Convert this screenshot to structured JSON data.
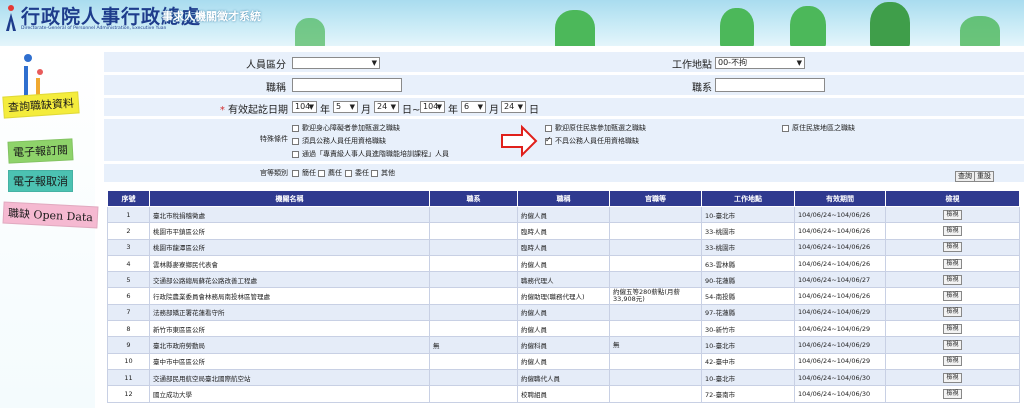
{
  "header": {
    "org_name": "行政院人事行政總處",
    "org_english": "Directorate-General of Personnel Administration, Executive Yuan",
    "system_title": "事求人機關徵才系統"
  },
  "sidebar": {
    "items": [
      {
        "label": "查詢職缺資料",
        "color": "#f4ec3c",
        "text_color": "#1a1a1a"
      },
      {
        "label": "電子報訂閱",
        "color": "#8ed36a",
        "text_color": "#1a1a1a"
      },
      {
        "label": "電子報取消",
        "color": "#4cc2b2",
        "text_color": "#1a1a1a"
      },
      {
        "label": "職缺 Open Data",
        "color": "#f5b9d1",
        "text_color": "#1a1a1a"
      }
    ]
  },
  "form": {
    "personnel_type_label": "人員區分",
    "personnel_type_value": "",
    "work_location_label": "工作地點",
    "work_location_value": "00-不拘",
    "title_label": "職稱",
    "title_value": "",
    "dept_label": "職系",
    "dept_value": "",
    "valid_date_label": "有效起訖日期",
    "required_mark": "*",
    "date_from": {
      "year": "104",
      "month": "5",
      "day": "24"
    },
    "date_to": {
      "year": "104",
      "month": "6",
      "day": "24"
    },
    "unit_year": "年",
    "unit_month": "月",
    "unit_day_range": "日~",
    "unit_day": "日",
    "special_label": "特殊條件",
    "special_options": [
      {
        "label": "歡迎身心障礙者參加甄選之職缺",
        "checked": false
      },
      {
        "label": "歡迎原住民族參加甄選之職缺",
        "checked": false
      },
      {
        "label": "原住民族地區之職缺",
        "checked": false
      },
      {
        "label": "須具公務人員任用資格職缺",
        "checked": false
      },
      {
        "label": "不具公務人員任用資格職缺",
        "checked": true
      },
      {
        "label": "通過「專責級人事人員進階職能培訓課程」人員",
        "checked": false
      }
    ],
    "rank_label": "官等類別",
    "rank_options": [
      {
        "label": "簡任",
        "checked": false
      },
      {
        "label": "薦任",
        "checked": false
      },
      {
        "label": "委任",
        "checked": false
      },
      {
        "label": "其他",
        "checked": false
      }
    ],
    "search_button": "查詢",
    "reset_button": "重設"
  },
  "table": {
    "headers": [
      "序號",
      "機關名稱",
      "職系",
      "職稱",
      "官職等",
      "工作地點",
      "有效期間",
      "檢視"
    ],
    "view_label": "檢視",
    "rows": [
      {
        "no": "1",
        "org": "臺北市稅捐稽徵處",
        "series": "",
        "title": "約僱人員",
        "rank": "",
        "location": "10-臺北市",
        "period": "104/06/24~104/06/26"
      },
      {
        "no": "2",
        "org": "桃園市平鎮區公所",
        "series": "",
        "title": "臨時人員",
        "rank": "",
        "location": "33-桃園市",
        "period": "104/06/24~104/06/26"
      },
      {
        "no": "3",
        "org": "桃園市龍潭區公所",
        "series": "",
        "title": "臨時人員",
        "rank": "",
        "location": "33-桃園市",
        "period": "104/06/24~104/06/26"
      },
      {
        "no": "4",
        "org": "雲林縣麥寮鄉民代表會",
        "series": "",
        "title": "約僱人員",
        "rank": "",
        "location": "63-雲林縣",
        "period": "104/06/24~104/06/26"
      },
      {
        "no": "5",
        "org": "交通部公路總局蘇花公路改善工程處",
        "series": "",
        "title": "職務代理人",
        "rank": "",
        "location": "90-花蓮縣",
        "period": "104/06/24~104/06/27"
      },
      {
        "no": "6",
        "org": "行政院農業委員會林務局南投林區管理處",
        "series": "",
        "title": "約僱助理(職務代理人)",
        "rank": "約僱五等280薪點(月薪33,908元)",
        "location": "54-南投縣",
        "period": "104/06/24~104/06/26"
      },
      {
        "no": "7",
        "org": "法務部矯正署花蓮看守所",
        "series": "",
        "title": "約僱人員",
        "rank": "",
        "location": "97-花蓮縣",
        "period": "104/06/24~104/06/29"
      },
      {
        "no": "8",
        "org": "新竹市東區區公所",
        "series": "",
        "title": "約僱人員",
        "rank": "",
        "location": "30-新竹市",
        "period": "104/06/24~104/06/29"
      },
      {
        "no": "9",
        "org": "臺北市政府勞動局",
        "series": "無",
        "title": "約僱科員",
        "rank": "無",
        "location": "10-臺北市",
        "period": "104/06/24~104/06/29"
      },
      {
        "no": "10",
        "org": "臺中市中區區公所",
        "series": "",
        "title": "約僱人員",
        "rank": "",
        "location": "42-臺中市",
        "period": "104/06/24~104/06/29"
      },
      {
        "no": "11",
        "org": "交通部民用航空局臺北國際航空站",
        "series": "",
        "title": "約僱職代人員",
        "rank": "",
        "location": "10-臺北市",
        "period": "104/06/24~104/06/30"
      },
      {
        "no": "12",
        "org": "國立成功大學",
        "series": "",
        "title": "校聘組員",
        "rank": "",
        "location": "72-臺南市",
        "period": "104/06/24~104/06/30"
      }
    ]
  }
}
